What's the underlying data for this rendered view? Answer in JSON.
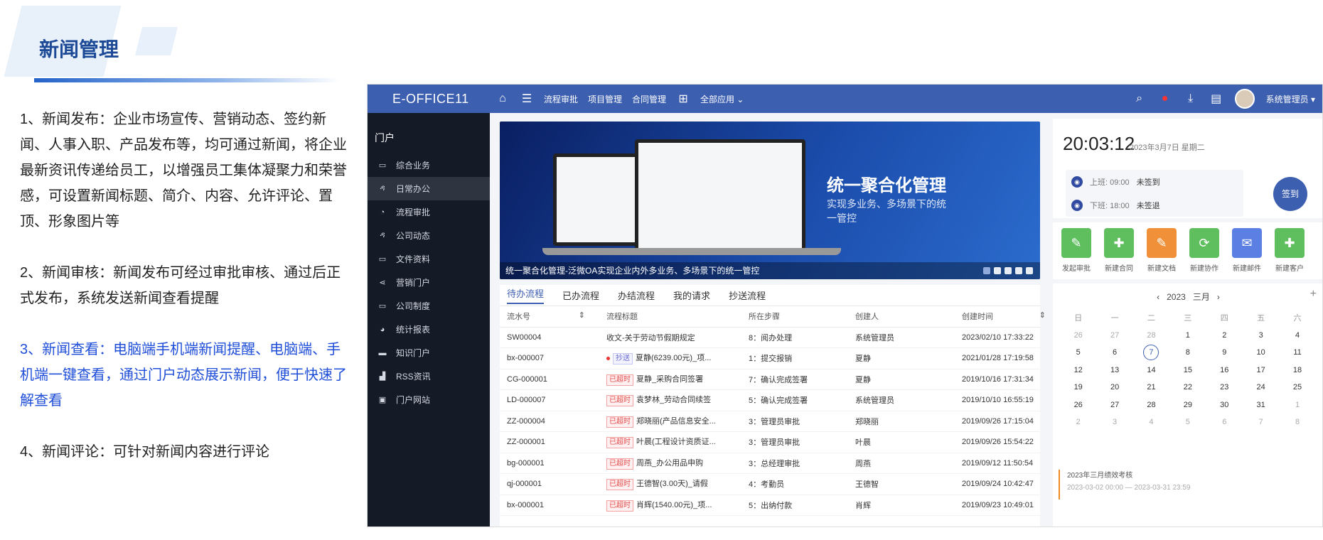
{
  "slide": {
    "title": "新闻管理",
    "paragraphs": [
      "1、新闻发布：企业市场宣传、营销动态、签约新闻、人事入职、产品发布等，均可通过新闻，将企业最新资讯传递给员工，以增强员工集体凝聚力和荣誉感，可设置新闻标题、简介、内容、允许评论、置顶、形象图片等",
      "2、新闻审核：新闻发布可经过审批审核、通过后正式发布，系统发送新闻查看提醒",
      "3、新闻查看：电脑端手机端新闻提醒、电脑端、手机端一键查看，通过门户动态展示新闻，便于快速了解查看",
      "4、新闻评论：可针对新闻内容进行评论"
    ]
  },
  "app": {
    "logo": "E-OFFICE11",
    "nav": [
      "流程审批",
      "项目管理",
      "合同管理",
      "全部应用"
    ],
    "user": "系统管理员",
    "sidebar_title": "门户",
    "sidebar": [
      "综合业务",
      "日常办公",
      "流程审批",
      "公司动态",
      "文件资料",
      "营销门户",
      "公司制度",
      "统计报表",
      "知识门户",
      "RSS资讯",
      "门户网站"
    ],
    "banner": {
      "title": "统一聚合化管理",
      "subtitle": "实现多业务、多场景下的统一管控",
      "caption": "统一聚合化管理-泛微OA实现企业内外多业务、多场景下的统一管控"
    },
    "tabs": [
      "待办流程",
      "已办流程",
      "办结流程",
      "我的请求",
      "抄送流程"
    ],
    "table_headers": [
      "流水号",
      "流程标题",
      "所在步骤",
      "创建人",
      "创建时间"
    ],
    "rows": [
      {
        "id": "SW00004",
        "tag": "",
        "title": "收文-关于劳动节假期规定",
        "step": "8：阅办处理",
        "creator": "系统管理员",
        "time": "2023/02/10 17:33:22"
      },
      {
        "id": "bx-000007",
        "tag": "抄送",
        "title": "夏静(6239.00元)_项...",
        "step": "1：提交报销",
        "creator": "夏静",
        "time": "2021/01/28 17:19:58"
      },
      {
        "id": "CG-000001",
        "tag": "已超时",
        "title": "夏静_采购合同签署",
        "step": "7：确认完成签署",
        "creator": "夏静",
        "time": "2019/10/16 17:31:34"
      },
      {
        "id": "LD-000007",
        "tag": "已超时",
        "title": "袁梦林_劳动合同续签",
        "step": "5：确认完成签署",
        "creator": "系统管理员",
        "time": "2019/10/10 16:55:19"
      },
      {
        "id": "ZZ-000004",
        "tag": "已超时",
        "title": "郑晓丽(产品信息安全...",
        "step": "3：管理员审批",
        "creator": "郑晓丽",
        "time": "2019/09/26 17:15:04"
      },
      {
        "id": "ZZ-000001",
        "tag": "已超时",
        "title": "叶晨(工程设计资质证...",
        "step": "3：管理员审批",
        "creator": "叶晨",
        "time": "2019/09/26 15:54:22"
      },
      {
        "id": "bg-000001",
        "tag": "已超时",
        "title": "周燕_办公用品申购",
        "step": "3：总经理审批",
        "creator": "周燕",
        "time": "2019/09/12 11:50:54"
      },
      {
        "id": "qj-000001",
        "tag": "已超时",
        "title": "王德智(3.00天)_请假",
        "step": "4：考勤员",
        "creator": "王德智",
        "time": "2019/09/24 10:42:47"
      },
      {
        "id": "bx-000001",
        "tag": "已超时",
        "title": "肖辉(1540.00元)_项...",
        "step": "5：出纳付款",
        "creator": "肖辉",
        "time": "2019/09/23 10:49:01"
      }
    ],
    "clock": {
      "time": "20:03:12",
      "date": "2023年3月7日  星期二"
    },
    "attendance": [
      {
        "label": "上班: 09:00",
        "status": "未签到"
      },
      {
        "label": "下班: 18:00",
        "status": "未签退"
      }
    ],
    "signin": "签到",
    "quick_apps": [
      {
        "label": "发起审批",
        "color": "#5fbf5f",
        "icon": "✎"
      },
      {
        "label": "新建合同",
        "color": "#5fbf5f",
        "icon": "✚"
      },
      {
        "label": "新建文档",
        "color": "#f0913a",
        "icon": "✎"
      },
      {
        "label": "新建协作",
        "color": "#5fbf5f",
        "icon": "⟳"
      },
      {
        "label": "新建邮件",
        "color": "#5b7fe3",
        "icon": "✉"
      },
      {
        "label": "新建客户",
        "color": "#5fbf5f",
        "icon": "✚"
      }
    ],
    "calendar": {
      "year": "2023",
      "month": "三月",
      "weekdays": [
        "日",
        "一",
        "二",
        "三",
        "四",
        "五",
        "六"
      ],
      "weeks": [
        [
          "26",
          "27",
          "28",
          "1",
          "2",
          "3",
          "4"
        ],
        [
          "5",
          "6",
          "7",
          "8",
          "9",
          "10",
          "11"
        ],
        [
          "12",
          "13",
          "14",
          "15",
          "16",
          "17",
          "18"
        ],
        [
          "19",
          "20",
          "21",
          "22",
          "23",
          "24",
          "25"
        ],
        [
          "26",
          "27",
          "28",
          "29",
          "30",
          "31",
          "1"
        ],
        [
          "2",
          "3",
          "4",
          "5",
          "6",
          "7",
          "8"
        ]
      ],
      "today": "7"
    },
    "event": {
      "title": "2023年三月绩效考核",
      "range": "2023-03-02 00:00 — 2023-03-31 23:59"
    }
  }
}
